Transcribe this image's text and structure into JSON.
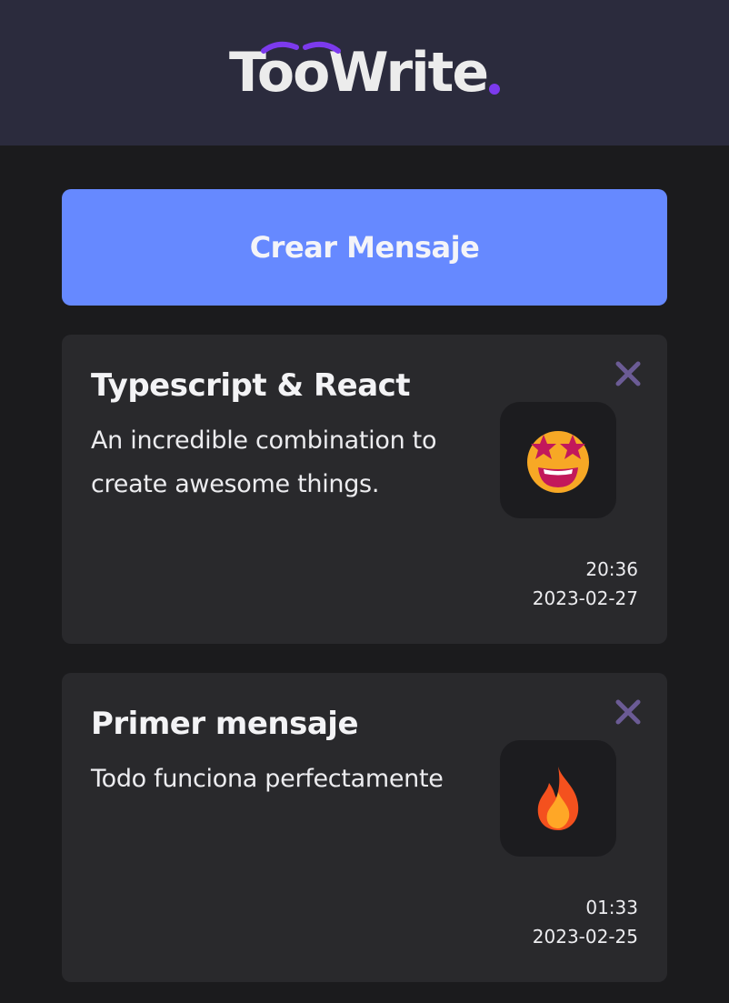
{
  "header": {
    "logo_text": "TooWrite",
    "logo_dot_color": "#7c3aed"
  },
  "actions": {
    "create_label": "Crear Mensaje"
  },
  "messages": [
    {
      "title": "Typescript & React",
      "body": "An incredible combination to create awesome things.",
      "emoji": "star-struck-icon",
      "time": "20:36",
      "date": "2023-02-27"
    },
    {
      "title": "Primer mensaje",
      "body": "Todo funciona perfectamente",
      "emoji": "fire-icon",
      "time": "01:33",
      "date": "2023-02-25"
    }
  ],
  "colors": {
    "header_bg": "#2b2b3d",
    "page_bg": "#1b1b1d",
    "accent_button": "#6689ff",
    "card_bg": "#29292c",
    "close_icon": "#6b5b95"
  }
}
